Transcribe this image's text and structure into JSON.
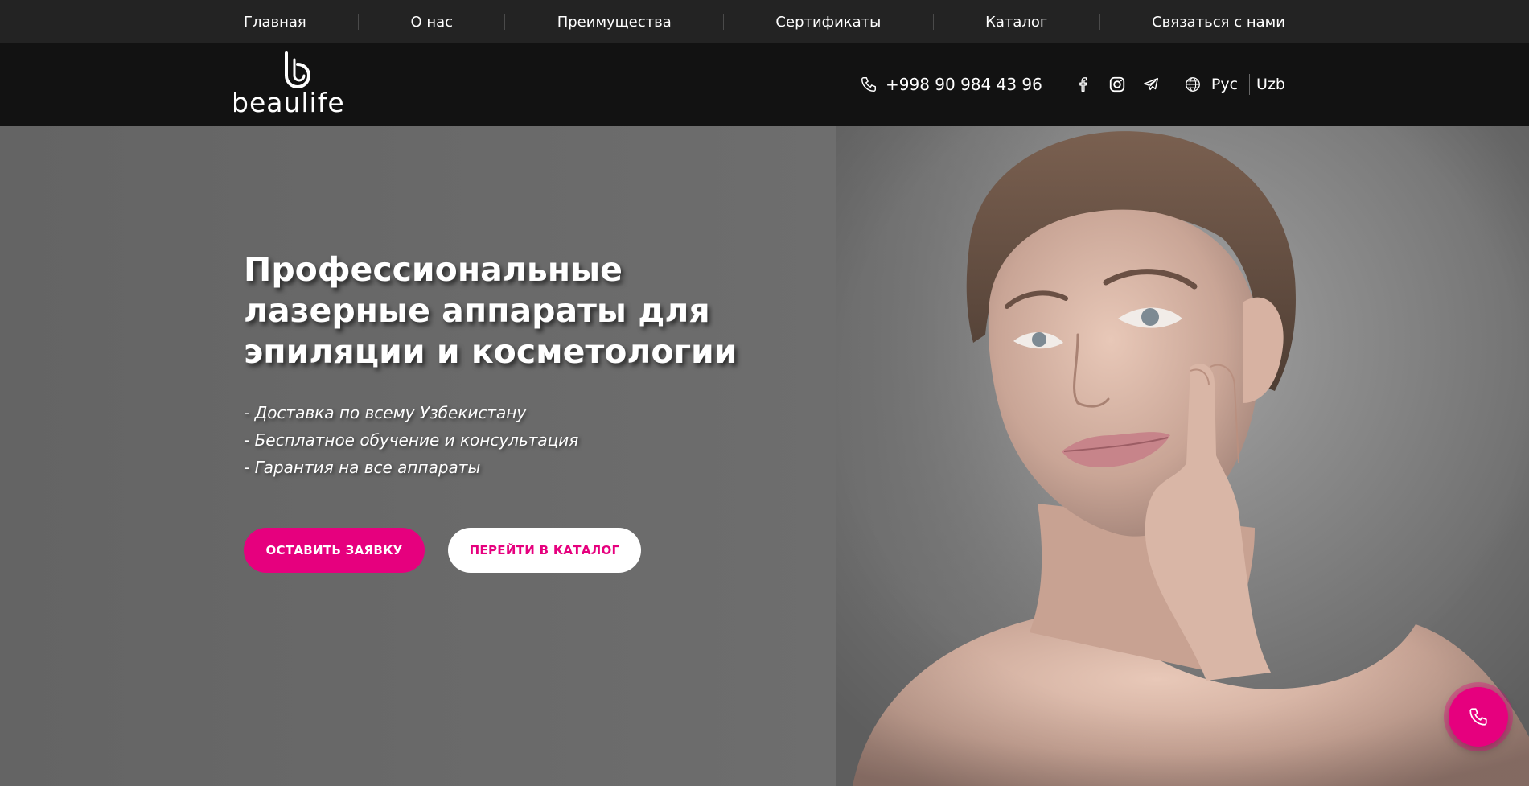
{
  "nav": {
    "items": [
      {
        "label": "Главная"
      },
      {
        "label": "О нас"
      },
      {
        "label": "Преимущества"
      },
      {
        "label": "Сертификаты"
      },
      {
        "label": "Каталог"
      },
      {
        "label": "Связаться с нами"
      }
    ]
  },
  "header": {
    "logo_text": "beaulife",
    "phone": "+998 90 984 43 96",
    "social_icons": [
      "facebook-icon",
      "instagram-icon",
      "telegram-icon"
    ],
    "languages": [
      {
        "label": "Рус"
      },
      {
        "label": "Uzb"
      }
    ]
  },
  "hero": {
    "title": "Профессиональные лазерные аппараты для эпиляции и косметологии",
    "bullets": [
      "- Доставка по всему Узбекистану",
      "- Бесплатное обучение и консультация",
      "- Гарантия на все аппараты"
    ],
    "primary_button": "ОСТАВИТЬ ЗАЯВКУ",
    "secondary_button": "ПЕРЕЙТИ В КАТАЛОГ"
  },
  "colors": {
    "accent": "#e6007e",
    "nav_bg": "#232323",
    "header_bg": "#121212"
  }
}
